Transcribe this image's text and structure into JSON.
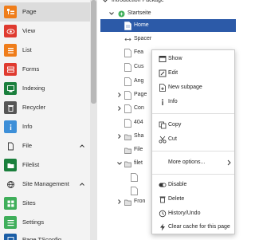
{
  "modules": [
    {
      "label": "Page",
      "icon": "page-tree-icon",
      "color": "#ef7d1a",
      "active": true
    },
    {
      "label": "View",
      "icon": "eye-icon",
      "color": "#df3a2f"
    },
    {
      "label": "List",
      "icon": "list-icon",
      "color": "#ef7d1a"
    },
    {
      "label": "Forms",
      "icon": "form-icon",
      "color": "#df3a2f"
    },
    {
      "label": "Indexing",
      "icon": "indexing-icon",
      "color": "#1a7f3c"
    },
    {
      "label": "Recycler",
      "icon": "trash-icon",
      "color": "#555555"
    },
    {
      "label": "Info",
      "icon": "info-icon",
      "color": "#3d8fd8"
    }
  ],
  "module_groups": [
    {
      "label": "File",
      "icon": "file-icon"
    },
    {
      "label": "Site Management",
      "icon": "site-management-icon"
    }
  ],
  "file_modules": [
    {
      "label": "Filelist",
      "icon": "filelist-icon",
      "color": "#1a7f3c"
    }
  ],
  "site_modules": [
    {
      "label": "Sites",
      "icon": "sites-icon",
      "color": "#3fae5a"
    },
    {
      "label": "Settings",
      "icon": "settings-icon",
      "color": "#3fae5a"
    },
    {
      "label": "Page TSconfig",
      "icon": "tsconfig-icon",
      "color": "#1b5ea6"
    }
  ],
  "tree": {
    "root_label": "Introduction Package",
    "site_label": "Startseite",
    "nodes": [
      {
        "label": "Home",
        "selected": true
      },
      {
        "label": "Spacer"
      },
      {
        "label": "Fea"
      },
      {
        "label": "Cus"
      },
      {
        "label": "Ang"
      },
      {
        "label": "Page"
      },
      {
        "label": "Con"
      },
      {
        "label": "404"
      },
      {
        "label": "Sha"
      },
      {
        "label": "File"
      },
      {
        "label": "filet"
      },
      {
        "label": "Fron"
      }
    ]
  },
  "context_menu": {
    "items": [
      {
        "label": "Show",
        "icon": "show-icon"
      },
      {
        "label": "Edit",
        "icon": "edit-icon"
      },
      {
        "label": "New subpage",
        "icon": "new-subpage-icon"
      },
      {
        "label": "Info",
        "icon": "info-icon"
      },
      {
        "label": "Copy",
        "icon": "copy-icon"
      },
      {
        "label": "Cut",
        "icon": "cut-icon"
      },
      {
        "label": "More options...",
        "icon": "",
        "submenu": true
      },
      {
        "label": "Disable",
        "icon": "toggle-icon"
      },
      {
        "label": "Delete",
        "icon": "delete-icon"
      },
      {
        "label": "History/Undo",
        "icon": "history-icon"
      },
      {
        "label": "Clear cache for this page",
        "icon": "flash-icon"
      }
    ]
  },
  "colors": {
    "selection": "#2c5aa8",
    "site_green": "#3fae5a"
  }
}
